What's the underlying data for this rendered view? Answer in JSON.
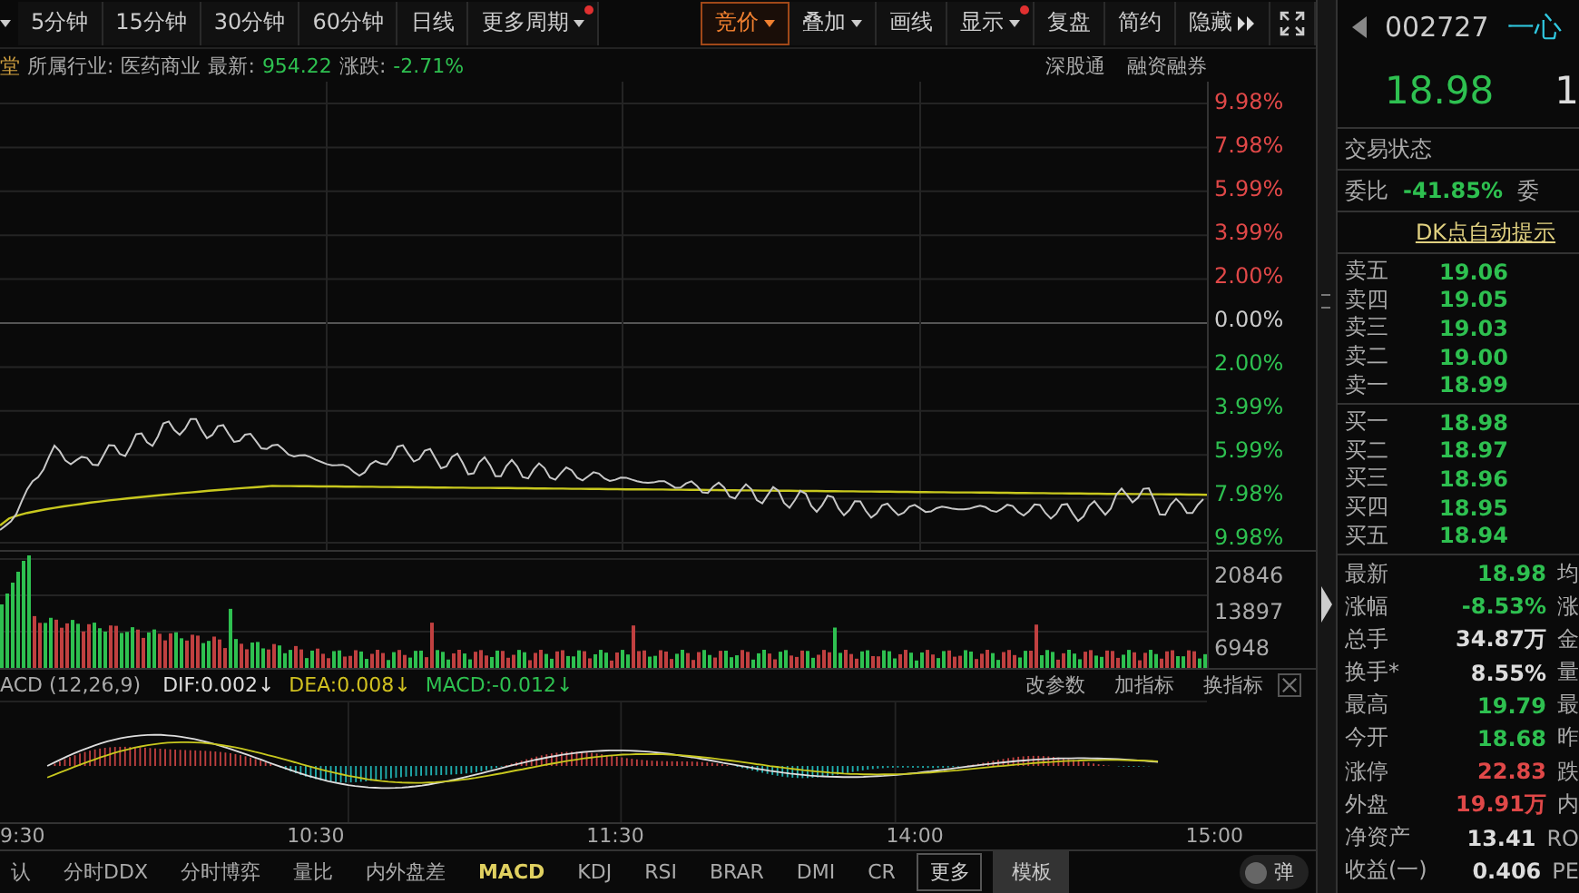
{
  "toolbar": {
    "periods": [
      {
        "label": "5分钟",
        "selected": false,
        "caret": false,
        "dot": false
      },
      {
        "label": "15分钟",
        "selected": false,
        "caret": false,
        "dot": false
      },
      {
        "label": "30分钟",
        "selected": false,
        "caret": false,
        "dot": false
      },
      {
        "label": "60分钟",
        "selected": false,
        "caret": false,
        "dot": false
      },
      {
        "label": "日线",
        "selected": false,
        "caret": false,
        "dot": false
      },
      {
        "label": "更多周期",
        "selected": false,
        "caret": true,
        "dot": true
      }
    ],
    "tools": [
      {
        "label": "竞价",
        "selected": true,
        "caret": true,
        "dot": false
      },
      {
        "label": "叠加",
        "selected": false,
        "caret": true,
        "dot": false
      },
      {
        "label": "画线",
        "selected": false,
        "caret": false,
        "dot": false
      },
      {
        "label": "显示",
        "selected": false,
        "caret": true,
        "dot": true
      },
      {
        "label": "复盘",
        "selected": false,
        "caret": false,
        "dot": false
      },
      {
        "label": "简约",
        "selected": false,
        "caret": false,
        "dot": false
      },
      {
        "label": "隐藏",
        "selected": false,
        "caret": false,
        "dot": false,
        "more": true
      }
    ]
  },
  "info": {
    "name_part": "堂",
    "industry_label": "所属行业:",
    "industry": "医药商业",
    "latest_label": "最新:",
    "latest": "954.22",
    "change_label": "涨跌:",
    "change": "-2.71%",
    "links": [
      "深股通",
      "融资融券"
    ]
  },
  "price_axis": [
    {
      "label": "9.98%",
      "color": "#e04848"
    },
    {
      "label": "7.98%",
      "color": "#e04848"
    },
    {
      "label": "5.99%",
      "color": "#e04848"
    },
    {
      "label": "3.99%",
      "color": "#e04848"
    },
    {
      "label": "2.00%",
      "color": "#e04848"
    },
    {
      "label": "0.00%",
      "color": "#cccccc"
    },
    {
      "label": "2.00%",
      "color": "#2ec050"
    },
    {
      "label": "3.99%",
      "color": "#2ec050"
    },
    {
      "label": "5.99%",
      "color": "#2ec050"
    },
    {
      "label": "7.98%",
      "color": "#2ec050"
    },
    {
      "label": "9.98%",
      "color": "#2ec050"
    }
  ],
  "volume_axis": [
    "20846",
    "13897",
    "6948"
  ],
  "macd": {
    "title": "ACD (12,26,9)",
    "dif": "DIF:0.002↓",
    "dea": "DEA:0.008↓",
    "value": "MACD:-0.012↓",
    "actions": [
      "改参数",
      "加指标",
      "换指标"
    ]
  },
  "time_axis": [
    "9:30",
    "10:30",
    "11:30",
    "14:00",
    "15:00"
  ],
  "indicator_tabs": [
    {
      "label": "认",
      "selected": false
    },
    {
      "label": "分时DDX",
      "selected": false
    },
    {
      "label": "分时博弈",
      "selected": false
    },
    {
      "label": "量比",
      "selected": false
    },
    {
      "label": "内外盘差",
      "selected": false
    },
    {
      "label": "MACD",
      "selected": true
    },
    {
      "label": "KDJ",
      "selected": false
    },
    {
      "label": "RSI",
      "selected": false
    },
    {
      "label": "BRAR",
      "selected": false
    },
    {
      "label": "DMI",
      "selected": false
    },
    {
      "label": "CR",
      "selected": false
    }
  ],
  "more_button": "更多",
  "template_button": "模板",
  "popup_toggle": {
    "label": "弹",
    "on": false
  },
  "quote": {
    "code": "002727",
    "name": "一心",
    "price": "18.98",
    "change_part": "1",
    "status_label": "交易状态",
    "ratio_label": "委比",
    "ratio": "-41.85%",
    "diff_label": "委",
    "dk_link": "DK点自动提示",
    "asks": [
      {
        "label": "卖五",
        "price": "19.06"
      },
      {
        "label": "卖四",
        "price": "19.05"
      },
      {
        "label": "卖三",
        "price": "19.03"
      },
      {
        "label": "卖二",
        "price": "19.00"
      },
      {
        "label": "卖一",
        "price": "18.99"
      }
    ],
    "bids": [
      {
        "label": "买一",
        "price": "18.98"
      },
      {
        "label": "买二",
        "price": "18.97"
      },
      {
        "label": "买三",
        "price": "18.96"
      },
      {
        "label": "买四",
        "price": "18.95"
      },
      {
        "label": "买五",
        "price": "18.94"
      }
    ],
    "stats": [
      {
        "label": "最新",
        "value": "18.98",
        "color": "#2ec050",
        "next": "均"
      },
      {
        "label": "涨幅",
        "value": "-8.53%",
        "color": "#2ec050",
        "next": "涨"
      },
      {
        "label": "总手",
        "value": "34.87万",
        "color": "#dddddd",
        "next": "金"
      },
      {
        "label": "换手*",
        "value": "8.55%",
        "color": "#dddddd",
        "next": "量"
      },
      {
        "label": "最高",
        "value": "19.79",
        "color": "#2ec050",
        "next": "最"
      },
      {
        "label": "今开",
        "value": "18.68",
        "color": "#2ec050",
        "next": "昨"
      },
      {
        "label": "涨停",
        "value": "22.83",
        "color": "#e04848",
        "next": "跌"
      },
      {
        "label": "外盘",
        "value": "19.91万",
        "color": "#e04848",
        "next": "内"
      },
      {
        "label": "净资产",
        "value": "13.41",
        "color": "#dddddd",
        "next": "RO"
      },
      {
        "label": "收益(一)",
        "value": "0.406",
        "color": "#dddddd",
        "next": "PE"
      }
    ]
  }
}
